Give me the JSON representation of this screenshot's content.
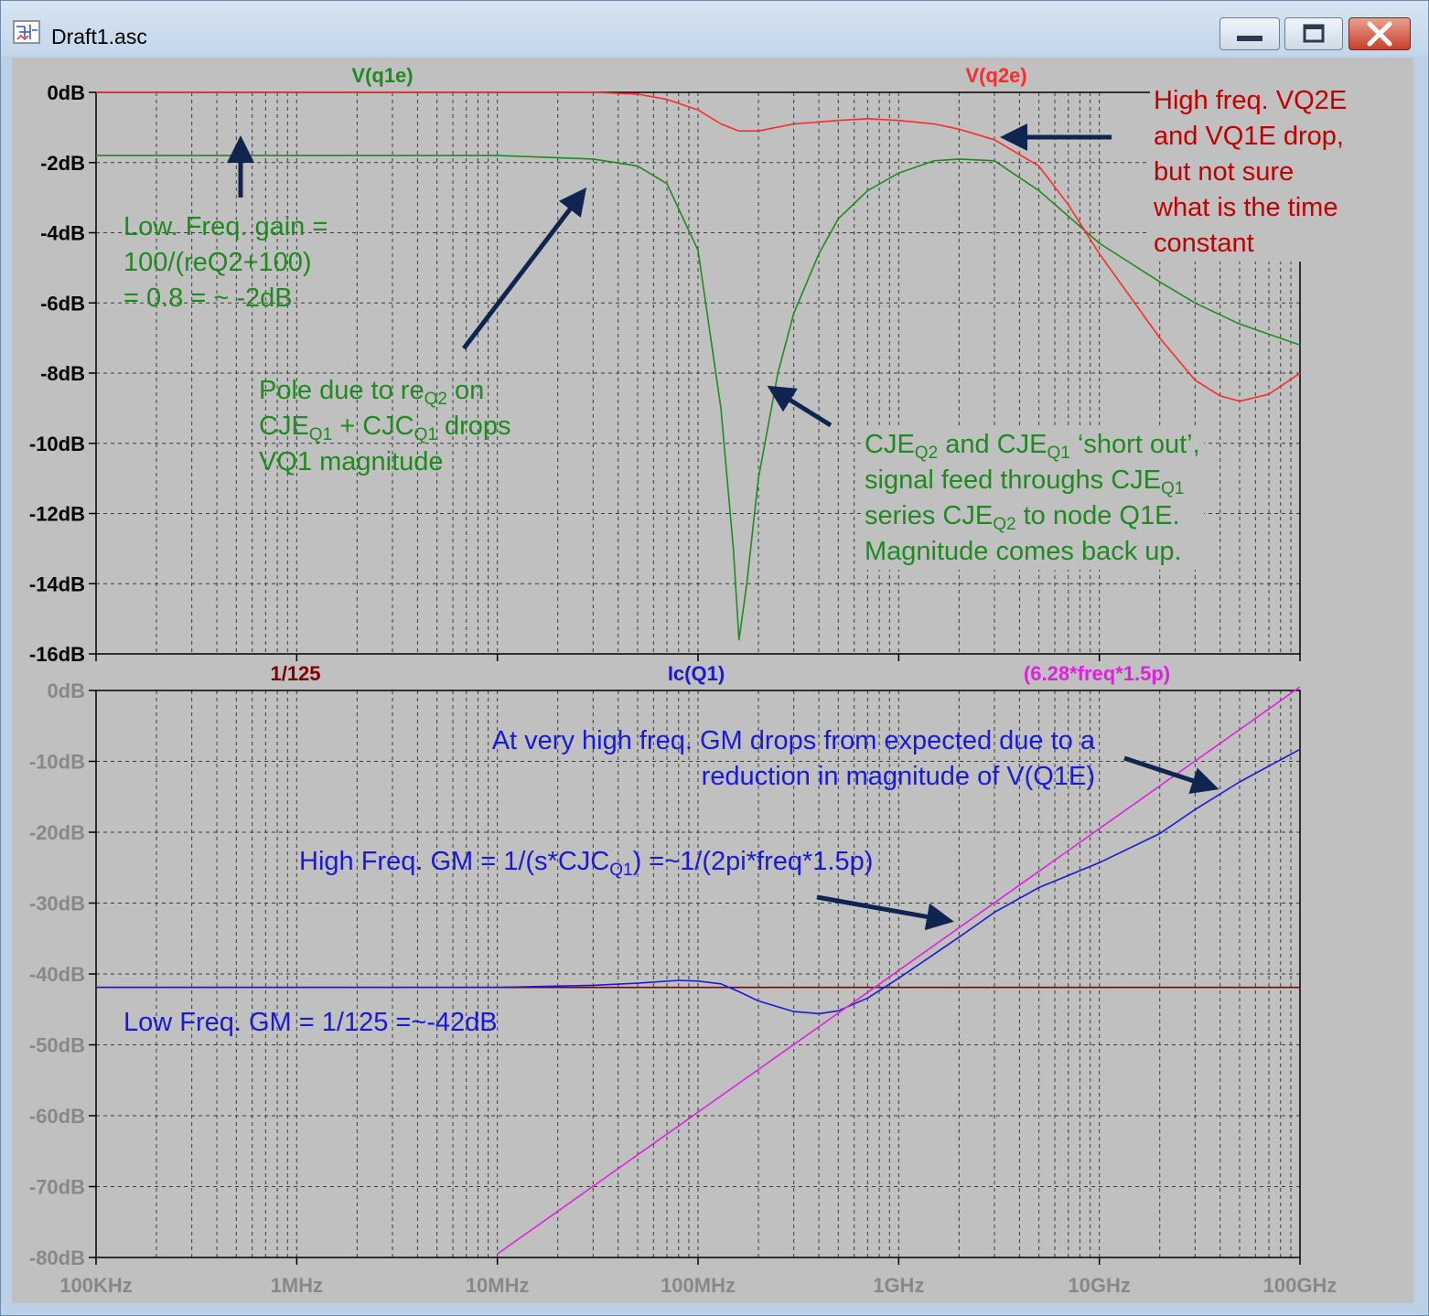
{
  "window": {
    "title": "Draft1.asc"
  },
  "colors": {
    "plot_bg": "#c0c0c0",
    "grid": "#3a3a3a",
    "green": "#1f8a1f",
    "red": "#ff2a2a",
    "blue": "#1a1ad6",
    "magenta": "#e020e0",
    "dark_red": "#800000",
    "arrow": "#0f2550"
  },
  "chart_data": [
    {
      "type": "line",
      "x_scale": "log",
      "x_ticks": [
        "100KHz",
        "1MHz",
        "10MHz",
        "100MHz",
        "1GHz",
        "10GHz",
        "100GHz"
      ],
      "y_ticks": [
        "0dB",
        "-2dB",
        "-4dB",
        "-6dB",
        "-8dB",
        "-10dB",
        "-12dB",
        "-14dB",
        "-16dB"
      ],
      "ylim": [
        -16,
        0
      ],
      "series": [
        {
          "name": "V(q1e)",
          "color": "#1f8a1f",
          "x": [
            100000.0,
            1000000.0,
            10000000.0,
            30000000.0,
            50000000.0,
            70000000.0,
            100000000.0,
            130000000.0,
            150000000.0,
            160000000.0,
            175000000.0,
            200000000.0,
            250000000.0,
            300000000.0,
            400000000.0,
            500000000.0,
            700000000.0,
            1000000000.0,
            1500000000.0,
            2000000000.0,
            3000000000.0,
            5000000000.0,
            10000000000.0,
            20000000000.0,
            30000000000.0,
            50000000000.0,
            100000000000.0
          ],
          "y": [
            -1.8,
            -1.8,
            -1.8,
            -1.9,
            -2.1,
            -2.6,
            -4.5,
            -9,
            -13,
            -15.6,
            -14,
            -11,
            -8,
            -6.3,
            -4.6,
            -3.6,
            -2.8,
            -2.3,
            -1.95,
            -1.9,
            -1.95,
            -2.8,
            -4.3,
            -5.4,
            -6,
            -6.6,
            -7.2
          ]
        },
        {
          "name": "V(q2e)",
          "color": "#ff2a2a",
          "x": [
            100000.0,
            1000000.0,
            10000000.0,
            30000000.0,
            50000000.0,
            70000000.0,
            100000000.0,
            130000000.0,
            160000000.0,
            200000000.0,
            300000000.0,
            500000000.0,
            700000000.0,
            1000000000.0,
            1500000000.0,
            2000000000.0,
            3000000000.0,
            5000000000.0,
            7000000000.0,
            10000000000.0,
            15000000000.0,
            20000000000.0,
            30000000000.0,
            40000000000.0,
            50000000000.0,
            70000000000.0,
            100000000000.0
          ],
          "y": [
            0,
            0,
            0,
            0,
            -0.05,
            -0.2,
            -0.5,
            -0.9,
            -1.1,
            -1.1,
            -0.9,
            -0.8,
            -0.75,
            -0.8,
            -0.9,
            -1.05,
            -1.35,
            -2.1,
            -3.2,
            -4.6,
            -6,
            -7,
            -8.2,
            -8.65,
            -8.8,
            -8.6,
            -8.0
          ]
        }
      ],
      "legend": [
        "V(q1e)",
        "V(q2e)"
      ]
    },
    {
      "type": "line",
      "x_scale": "log",
      "x_ticks": [
        "100KHz",
        "1MHz",
        "10MHz",
        "100MHz",
        "1GHz",
        "10GHz",
        "100GHz"
      ],
      "y_ticks": [
        "0dB",
        "-10dB",
        "-20dB",
        "-30dB",
        "-40dB",
        "-50dB",
        "-60dB",
        "-70dB",
        "-80dB"
      ],
      "ylim": [
        -80,
        0
      ],
      "series": [
        {
          "name": "1/125",
          "color": "#800000",
          "x": [
            100000.0,
            100000000000.0
          ],
          "y": [
            -41.9,
            -41.9
          ]
        },
        {
          "name": "Ic(Q1)",
          "color": "#1a1ad6",
          "x": [
            100000.0,
            1000000.0,
            10000000.0,
            30000000.0,
            50000000.0,
            80000000.0,
            100000000.0,
            130000000.0,
            160000000.0,
            200000000.0,
            300000000.0,
            400000000.0,
            500000000.0,
            700000000.0,
            1000000000.0,
            2000000000.0,
            3000000000.0,
            5000000000.0,
            10000000000.0,
            20000000000.0,
            30000000000.0,
            50000000000.0,
            100000000000.0
          ],
          "y": [
            -41.9,
            -41.9,
            -41.9,
            -41.6,
            -41.3,
            -40.9,
            -41,
            -41.4,
            -42.5,
            -43.8,
            -45.3,
            -45.6,
            -45.2,
            -43.4,
            -40.6,
            -34.8,
            -31.3,
            -27.8,
            -24.3,
            -20.2,
            -16.8,
            -12.9,
            -8.3
          ]
        },
        {
          "name": "(6.28*freq*1.5p)",
          "color": "#e020e0",
          "x": [
            10000000.0,
            100000000000.0
          ],
          "y": [
            -79.5,
            0.5
          ]
        }
      ],
      "legend": [
        "1/125",
        "Ic(Q1)",
        "(6.28*freq*1.5p)"
      ]
    }
  ],
  "annotations": {
    "low_freq_gain": [
      "Low. Freq. gain =",
      "100/(reQ2+100)",
      "= 0.8 = ~ -2dB"
    ],
    "pole": {
      "line1_a": "Pole due to re",
      "line1_sub": "Q2",
      "line1_b": " on",
      "line2_a": "CJE",
      "line2_sub1": "Q1",
      "line2_b": " + CJC",
      "line2_sub2": "Q1",
      "line2_c": " drops",
      "line3": "VQ1 magnitude"
    },
    "cje_short": {
      "l1_a": "CJE",
      "l1_s1": "Q2",
      "l1_b": " and CJE",
      "l1_s2": "Q1",
      "l1_c": " ‘short out’,",
      "l2_a": "signal feed throughs CJE",
      "l2_s": "Q1",
      "l3_a": "series CJE",
      "l3_s": "Q2",
      "l3_b": " to node Q1E.",
      "l4": "Magnitude comes back up."
    },
    "high_freq_drop": [
      "High freq. VQ2E",
      "and VQ1E drop,",
      "but not sure",
      "what is the  time",
      "constant"
    ],
    "gm_drop": [
      "At very high freq. GM drops from expected due to a",
      "reduction in magnitude of V(Q1E)"
    ],
    "high_freq_gm": {
      "a": "High Freq. GM = 1/(s*CJC",
      "sub": "Q1",
      "b": ") =~1/(2pi*freq*1.5p)"
    },
    "low_freq_gm": "Low Freq. GM = 1/125 =~-42dB"
  }
}
